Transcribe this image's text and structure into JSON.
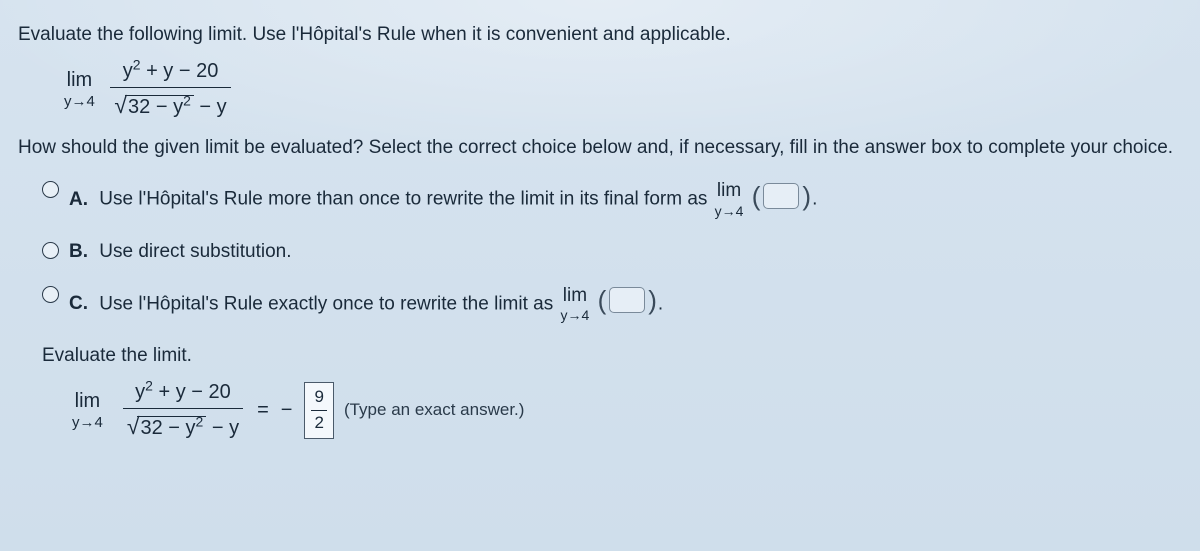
{
  "prompt": "Evaluate the following limit. Use l'Hôpital's Rule when it is convenient and applicable.",
  "limit": {
    "op": "lim",
    "approach": "y→4",
    "numerator_pre": "y",
    "numerator_post": " + y − 20",
    "den_pre_sqrt": "",
    "den_radicand_pre": "32 − y",
    "den_post": " − y"
  },
  "question2": "How should the given limit be evaluated? Select the correct choice below and, if necessary, fill in the answer box to complete your choice.",
  "choices": {
    "A": {
      "label": "A.",
      "text_before": "Use l'Hôpital's Rule more than once to rewrite the limit in its final form as ",
      "lim_op": "lim",
      "lim_sub": "y→4",
      "text_after": "."
    },
    "B": {
      "label": "B.",
      "text": "Use direct substitution."
    },
    "C": {
      "label": "C.",
      "text_before": "Use l'Hôpital's Rule exactly once to rewrite the limit as ",
      "lim_op": "lim",
      "lim_sub": "y→4",
      "text_after": "."
    }
  },
  "eval_title": "Evaluate the limit.",
  "result": {
    "equals": "=",
    "neg": "−",
    "num": "9",
    "den": "2",
    "hint": "(Type an exact answer.)"
  }
}
